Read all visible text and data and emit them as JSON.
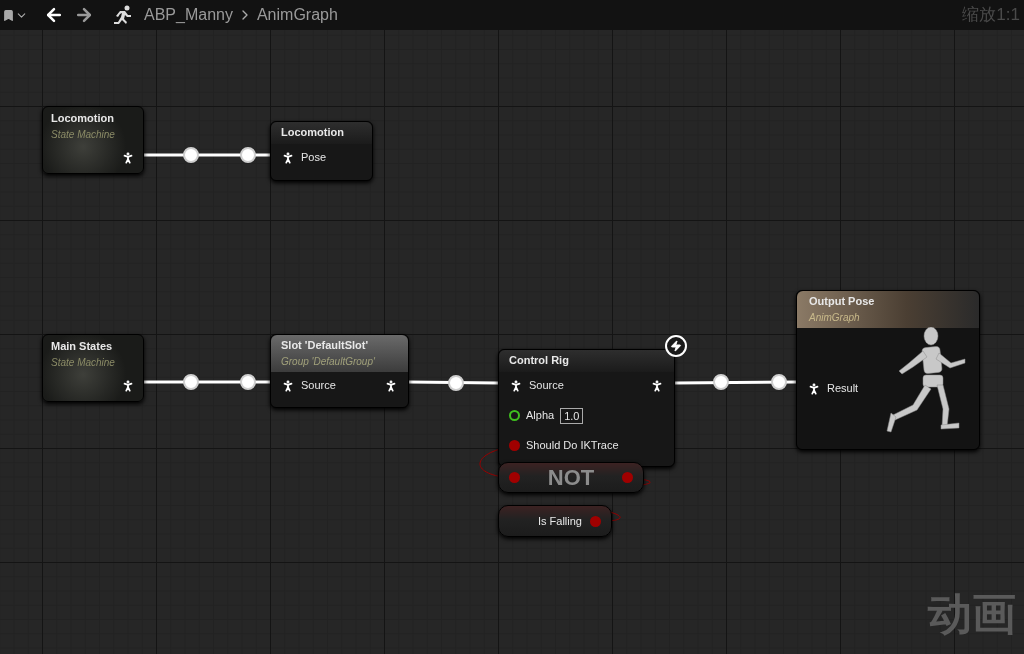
{
  "toolbar": {
    "breadcrumb": [
      "ABP_Manny",
      "AnimGraph"
    ],
    "zoom": "缩放1:1"
  },
  "nodes": [
    {
      "kind": "state_machine",
      "title": "Locomotion",
      "subtitle": "State Machine",
      "outputs": [
        {
          "kind": "pose"
        }
      ]
    },
    {
      "kind": "graph_node",
      "title": "Locomotion",
      "inputs": [
        {
          "kind": "pose",
          "label": "Pose"
        }
      ]
    },
    {
      "kind": "state_machine",
      "title": "Main States",
      "subtitle": "State Machine",
      "outputs": [
        {
          "kind": "pose"
        }
      ]
    },
    {
      "kind": "graph_node",
      "title": "Slot 'DefaultSlot'",
      "subtitle": "Group 'DefaultGroup'",
      "inputs": [
        {
          "kind": "pose",
          "label": "Source"
        }
      ],
      "outputs": [
        {
          "kind": "pose"
        }
      ]
    },
    {
      "kind": "graph_node",
      "title": "Control Rig",
      "badge": true,
      "inputs": [
        {
          "kind": "pose",
          "label": "Source"
        },
        {
          "kind": "float",
          "label": "Alpha",
          "value": "1.0"
        },
        {
          "kind": "bool",
          "label": "Should Do IKTrace"
        }
      ],
      "outputs": [
        {
          "kind": "pose"
        }
      ]
    },
    {
      "kind": "compact",
      "title": "NOT",
      "inputs": [
        {
          "kind": "bool"
        }
      ],
      "outputs": [
        {
          "kind": "bool"
        }
      ]
    },
    {
      "kind": "compact",
      "title": "Is Falling",
      "outputs": [
        {
          "kind": "bool"
        }
      ]
    },
    {
      "kind": "result",
      "title": "Output Pose",
      "subtitle": "AnimGraph",
      "inputs": [
        {
          "kind": "pose",
          "label": "Result"
        }
      ]
    }
  ],
  "graph_type": "动画"
}
